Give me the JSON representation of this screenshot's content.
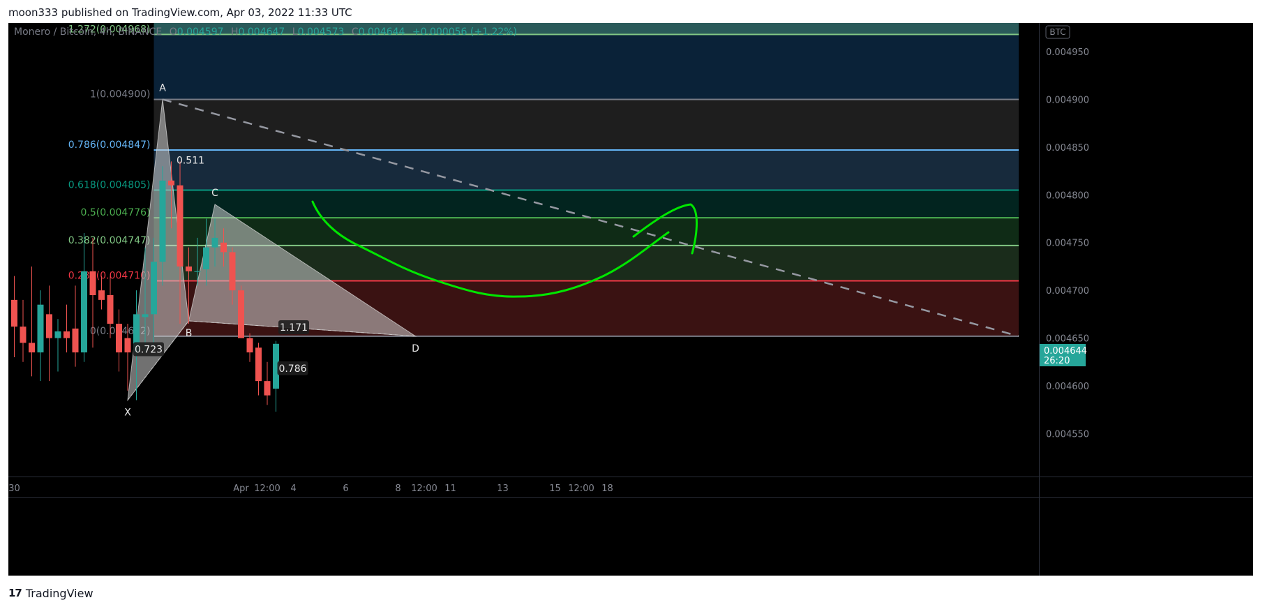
{
  "header": {
    "published_line": "moon333 published on TradingView.com, Apr 03, 2022 11:33 UTC"
  },
  "footer": {
    "brand": "TradingView"
  },
  "legend": {
    "symbol": "Monero / Bitcoin, 4h, BINANCE",
    "o_key": "O",
    "o_val": "0.004597",
    "h_key": "H",
    "h_val": "0.004647",
    "l_key": "L",
    "l_val": "0.004573",
    "c_key": "C",
    "c_val": "0.004644",
    "change": "+0.000056 (+1.22%)"
  },
  "price_axis": {
    "currency_badge": "BTC",
    "last_price": "0.004644",
    "countdown": "26:20",
    "ticks": [
      {
        "value": 0.00495,
        "label": "0.004950"
      },
      {
        "value": 0.0049,
        "label": "0.004900"
      },
      {
        "value": 0.00485,
        "label": "0.004850"
      },
      {
        "value": 0.0048,
        "label": "0.004800"
      },
      {
        "value": 0.00475,
        "label": "0.004750"
      },
      {
        "value": 0.0047,
        "label": "0.004700"
      },
      {
        "value": 0.00465,
        "label": "0.004650"
      },
      {
        "value": 0.0046,
        "label": "0.004600"
      },
      {
        "value": 0.00455,
        "label": "0.004550"
      }
    ]
  },
  "time_axis": {
    "ticks": [
      {
        "t": 0,
        "label": "30"
      },
      {
        "t": 26,
        "label": "Apr"
      },
      {
        "t": 29,
        "label": "12:00"
      },
      {
        "t": 32,
        "label": "4"
      },
      {
        "t": 38,
        "label": "6"
      },
      {
        "t": 44,
        "label": "8"
      },
      {
        "t": 47,
        "label": "12:00"
      },
      {
        "t": 50,
        "label": "11"
      },
      {
        "t": 56,
        "label": "13"
      },
      {
        "t": 62,
        "label": "15"
      },
      {
        "t": 65,
        "label": "12:00"
      },
      {
        "t": 68,
        "label": "18"
      }
    ]
  },
  "chart_data": {
    "type": "candlestick",
    "title": "Monero / Bitcoin, 4h, BINANCE",
    "y_range": [
      0.004505,
      0.00498
    ],
    "colors": {
      "up": "#26a69a",
      "down": "#ef5350",
      "drawing": "#00e600"
    },
    "candles": [
      {
        "t": 0,
        "o": 0.00469,
        "h": 0.004715,
        "l": 0.00463,
        "c": 0.004662
      },
      {
        "t": 1,
        "o": 0.004662,
        "h": 0.00469,
        "l": 0.004625,
        "c": 0.004645
      },
      {
        "t": 2,
        "o": 0.004645,
        "h": 0.004725,
        "l": 0.00461,
        "c": 0.004635
      },
      {
        "t": 3,
        "o": 0.004635,
        "h": 0.0047,
        "l": 0.004605,
        "c": 0.004685
      },
      {
        "t": 4,
        "o": 0.004675,
        "h": 0.004705,
        "l": 0.004605,
        "c": 0.00465
      },
      {
        "t": 5,
        "o": 0.00465,
        "h": 0.00467,
        "l": 0.004615,
        "c": 0.004657
      },
      {
        "t": 6,
        "o": 0.004657,
        "h": 0.004685,
        "l": 0.004635,
        "c": 0.00465
      },
      {
        "t": 7,
        "o": 0.00466,
        "h": 0.004705,
        "l": 0.00462,
        "c": 0.004635
      },
      {
        "t": 8,
        "o": 0.004635,
        "h": 0.00476,
        "l": 0.004625,
        "c": 0.00472
      },
      {
        "t": 9,
        "o": 0.00472,
        "h": 0.004755,
        "l": 0.00464,
        "c": 0.004695
      },
      {
        "t": 10,
        "o": 0.0047,
        "h": 0.004715,
        "l": 0.00468,
        "c": 0.00469
      },
      {
        "t": 11,
        "o": 0.004695,
        "h": 0.004715,
        "l": 0.00465,
        "c": 0.004665
      },
      {
        "t": 12,
        "o": 0.004665,
        "h": 0.00468,
        "l": 0.004615,
        "c": 0.004635
      },
      {
        "t": 13,
        "o": 0.00465,
        "h": 0.004665,
        "l": 0.004595,
        "c": 0.004635
      },
      {
        "t": 14,
        "o": 0.004635,
        "h": 0.0047,
        "l": 0.004585,
        "c": 0.004675
      },
      {
        "t": 15,
        "o": 0.004672,
        "h": 0.004745,
        "l": 0.004635,
        "c": 0.004675
      },
      {
        "t": 16,
        "o": 0.004675,
        "h": 0.004755,
        "l": 0.00464,
        "c": 0.00473
      },
      {
        "t": 17,
        "o": 0.00473,
        "h": 0.00483,
        "l": 0.004705,
        "c": 0.004815
      },
      {
        "t": 18,
        "o": 0.004815,
        "h": 0.004835,
        "l": 0.004765,
        "c": 0.00481
      },
      {
        "t": 19,
        "o": 0.00481,
        "h": 0.004835,
        "l": 0.004665,
        "c": 0.004725
      },
      {
        "t": 20,
        "o": 0.004725,
        "h": 0.004745,
        "l": 0.004665,
        "c": 0.00472
      },
      {
        "t": 21,
        "o": 0.00472,
        "h": 0.004755,
        "l": 0.004705,
        "c": 0.00472
      },
      {
        "t": 22,
        "o": 0.004722,
        "h": 0.004775,
        "l": 0.004705,
        "c": 0.004745
      },
      {
        "t": 23,
        "o": 0.004745,
        "h": 0.004775,
        "l": 0.004725,
        "c": 0.004755
      },
      {
        "t": 24,
        "o": 0.00475,
        "h": 0.004765,
        "l": 0.004725,
        "c": 0.00474
      },
      {
        "t": 25,
        "o": 0.00474,
        "h": 0.004745,
        "l": 0.004685,
        "c": 0.0047
      },
      {
        "t": 26,
        "o": 0.0047,
        "h": 0.004705,
        "l": 0.00465,
        "c": 0.00465
      },
      {
        "t": 27,
        "o": 0.00465,
        "h": 0.004655,
        "l": 0.004625,
        "c": 0.004635
      },
      {
        "t": 28,
        "o": 0.00464,
        "h": 0.004645,
        "l": 0.00459,
        "c": 0.004605
      },
      {
        "t": 29,
        "o": 0.004605,
        "h": 0.004625,
        "l": 0.00458,
        "c": 0.00459
      },
      {
        "t": 30,
        "o": 0.004597,
        "h": 0.004647,
        "l": 0.004573,
        "c": 0.004644
      }
    ],
    "bar_spacing_px": 12.5,
    "fib_retracement": {
      "levels": [
        {
          "ratio": "1.272",
          "price": 0.004968,
          "label": "1.272(0.004968)",
          "color": "#81c784"
        },
        {
          "ratio": "1",
          "price": 0.0049,
          "label": "1(0.004900)",
          "color": "#787b86"
        },
        {
          "ratio": "0.786",
          "price": 0.004847,
          "label": "0.786(0.004847)",
          "color": "#64b5f6"
        },
        {
          "ratio": "0.618",
          "price": 0.004805,
          "label": "0.618(0.004805)",
          "color": "#089981"
        },
        {
          "ratio": "0.5",
          "price": 0.004776,
          "label": "0.5(0.004776)",
          "color": "#4caf50"
        },
        {
          "ratio": "0.382",
          "price": 0.004747,
          "label": "0.382(0.004747)",
          "color": "#81c784"
        },
        {
          "ratio": "0.236",
          "price": 0.00471,
          "label": "0.236(0.004710)",
          "color": "#f23645"
        },
        {
          "ratio": "0",
          "price": 0.004652,
          "label": "0(0.004652)",
          "color": "#787b86"
        }
      ],
      "bands": [
        {
          "top": 0.00498,
          "bottom": 0.004968,
          "color": "#2a5a5a"
        },
        {
          "top": 0.004968,
          "bottom": 0.0049,
          "color": "#0a2238"
        },
        {
          "top": 0.0049,
          "bottom": 0.004847,
          "color": "#1e1e1e"
        },
        {
          "top": 0.004847,
          "bottom": 0.004805,
          "color": "#172a3c"
        },
        {
          "top": 0.004805,
          "bottom": 0.004776,
          "color": "#02241f"
        },
        {
          "top": 0.004776,
          "bottom": 0.004747,
          "color": "#0f2b16"
        },
        {
          "top": 0.004747,
          "bottom": 0.00471,
          "color": "#1a2c1b"
        },
        {
          "top": 0.00471,
          "bottom": 0.004652,
          "color": "#3a1212"
        }
      ]
    },
    "harmonic_pattern": {
      "points": [
        {
          "name": "X",
          "t": 13,
          "price": 0.004585
        },
        {
          "name": "A",
          "t": 17,
          "price": 0.0049
        },
        {
          "name": "B",
          "t": 20,
          "price": 0.004668
        },
        {
          "name": "C",
          "t": 23,
          "price": 0.00479
        },
        {
          "name": "D",
          "t": 46,
          "price": 0.004652
        }
      ],
      "ratios": [
        {
          "label": "0.723"
        },
        {
          "label": "0.511"
        },
        {
          "label": "1.171"
        },
        {
          "label": "0.786"
        }
      ]
    },
    "trend_line": {
      "t1": 17,
      "p1": 0.0049,
      "t2": 111,
      "p2": 0.004652
    }
  }
}
